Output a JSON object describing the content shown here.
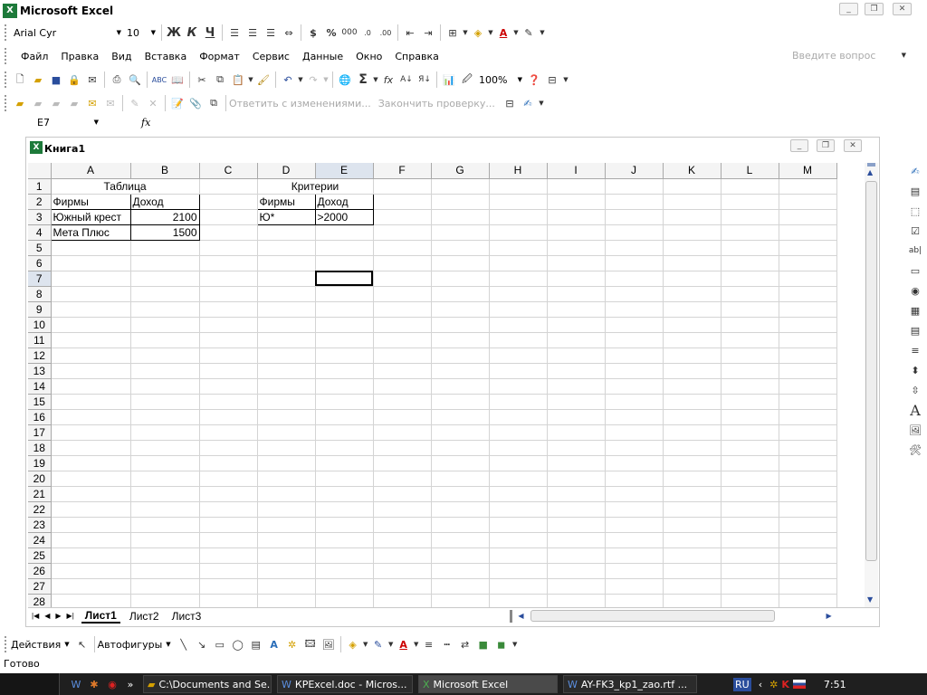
{
  "app": {
    "title": "Microsoft Excel"
  },
  "format_bar": {
    "font": "Arial Cyr",
    "size": "10",
    "bold": "Ж",
    "italic": "К",
    "underline": "Ч",
    "currency": "$",
    "percent": "%",
    "thousands": "000"
  },
  "menu": {
    "items": [
      "Файл",
      "Правка",
      "Вид",
      "Вставка",
      "Формат",
      "Сервис",
      "Данные",
      "Окно",
      "Справка"
    ],
    "help_placeholder": "Введите вопрос"
  },
  "standard_bar": {
    "zoom": "100%",
    "sigma": "Σ",
    "fx": "fx"
  },
  "review_bar": {
    "reply": "Ответить с изменениями...",
    "finish": "Закончить проверку..."
  },
  "formula_bar": {
    "name_box": "E7",
    "fx": "fx",
    "value": ""
  },
  "workbook": {
    "title": "Книга1"
  },
  "sheet": {
    "columns": [
      "A",
      "B",
      "C",
      "D",
      "E",
      "F",
      "G",
      "H",
      "I",
      "J",
      "K",
      "L",
      "M"
    ],
    "rows": [
      "1",
      "2",
      "3",
      "4",
      "5",
      "6",
      "7",
      "8",
      "9",
      "10",
      "11",
      "12",
      "13",
      "14",
      "15",
      "16",
      "17",
      "18",
      "19",
      "20",
      "21",
      "22",
      "23",
      "24",
      "25",
      "26",
      "27",
      "28"
    ],
    "cells": {
      "A1": "Таблица",
      "A2": "Фирмы",
      "B2": "Доход",
      "A3": "Южный крест",
      "B3": "2100",
      "A4": "Мета Плюс",
      "B4": "1500",
      "D1": "Критерии",
      "D2": "Фирмы",
      "E2": "Доход",
      "D3": "Ю*",
      "E3": ">2000"
    },
    "active_cell": "E7",
    "tabs": [
      "Лист1",
      "Лист2",
      "Лист3"
    ],
    "active_tab": "Лист1"
  },
  "drawing_bar": {
    "actions": "Действия",
    "autoshapes": "Автофигуры"
  },
  "status": {
    "text": "Готово"
  },
  "taskbar": {
    "items": [
      "C:\\Documents and Se...",
      "КРExcel.doc - Micros...",
      "Microsoft Excel",
      "AY-FK3_kp1_zao.rtf ..."
    ],
    "active": "Microsoft Excel",
    "lang": "RU",
    "time": "7:51"
  }
}
